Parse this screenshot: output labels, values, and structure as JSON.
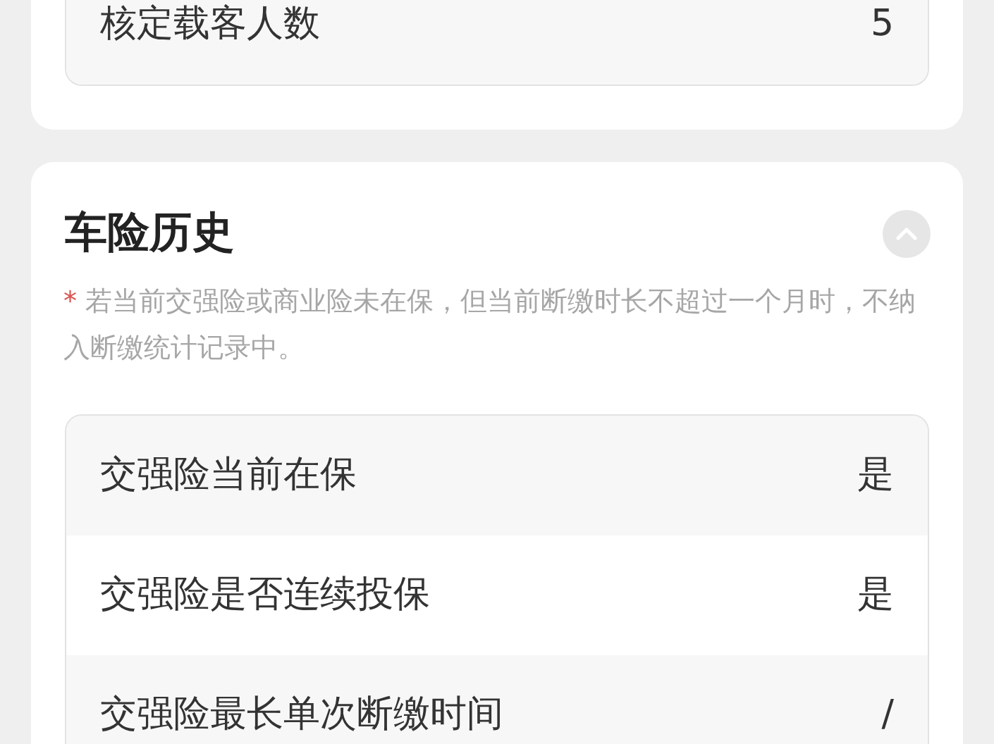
{
  "vehicle_info": {
    "rows": [
      {
        "label": "核定载客人数",
        "value": "5"
      }
    ]
  },
  "insurance_history": {
    "title": "车险历史",
    "expanded": true,
    "note": {
      "mark": "*",
      "text": "若当前交强险或商业险未在保，但当前断缴时长不超过一个月时，不纳入断缴统计记录中。"
    },
    "rows": [
      {
        "label": "交强险当前在保",
        "value": "是"
      },
      {
        "label": "交强险是否连续投保",
        "value": "是"
      },
      {
        "label": "交强险最长单次断缴时间",
        "value": "/"
      }
    ]
  }
}
